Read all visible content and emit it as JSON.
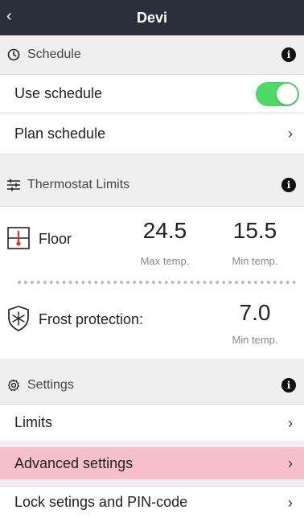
{
  "header": {
    "back_icon": "chevron-left-icon",
    "title": "Devi"
  },
  "schedule": {
    "title": "Schedule",
    "use_schedule_label": "Use schedule",
    "use_schedule_on": true,
    "plan_schedule_label": "Plan schedule"
  },
  "thermostat": {
    "title": "Thermostat Limits",
    "floor": {
      "label": "Floor",
      "max_value": "24.5",
      "max_label": "Max temp.",
      "min_value": "15.5",
      "min_label": "Min temp."
    },
    "frost": {
      "label": "Frost protection:",
      "min_value": "7.0",
      "min_label": "Min temp."
    }
  },
  "settings": {
    "title": "Settings",
    "items": [
      {
        "label": "Limits"
      },
      {
        "label": "Advanced settings"
      },
      {
        "label": "Lock setings and PIN-code"
      }
    ]
  },
  "colors": {
    "topbar": "#2b2f3a",
    "toggle_on": "#4cd964",
    "highlight": "#f5c0ca"
  }
}
